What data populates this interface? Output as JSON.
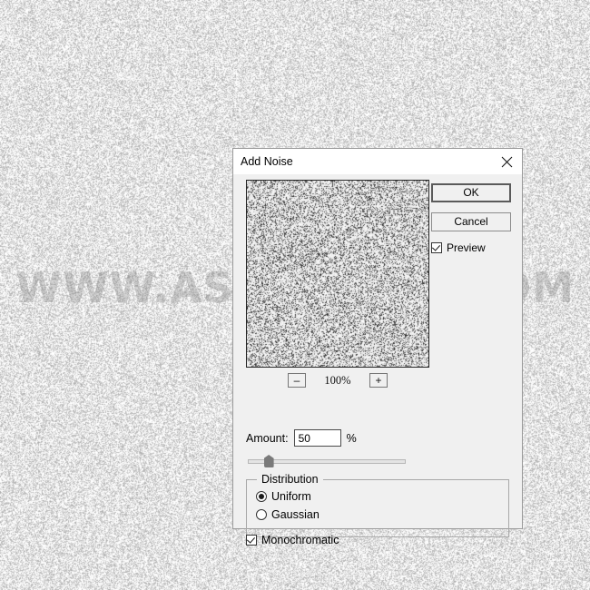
{
  "background": {
    "watermark_text": "WWW.ASDFGHJKL.COM",
    "noise_description": "monochromatic-uniform-noise"
  },
  "dialog": {
    "title": "Add Noise",
    "close_icon": "close-icon",
    "buttons": {
      "ok_label": "OK",
      "cancel_label": "Cancel"
    },
    "preview_checkbox": {
      "label": "Preview",
      "checked": true
    },
    "preview": {
      "zoom_out_label": "–",
      "zoom_in_label": "+",
      "zoom_level": "100%"
    },
    "amount": {
      "label": "Amount:",
      "value": "50",
      "unit": "%",
      "slider_percent": 13
    },
    "distribution": {
      "legend": "Distribution",
      "options": [
        {
          "label": "Uniform",
          "selected": true
        },
        {
          "label": "Gaussian",
          "selected": false
        }
      ]
    },
    "monochromatic": {
      "label": "Monochromatic",
      "checked": true
    }
  },
  "colors": {
    "dialog_face": "#f0f0f0",
    "titlebar": "#ffffff",
    "border": "#9a9a9a",
    "default_button_border": "#5a5a5a",
    "slider_thumb": "#7a7a7a"
  }
}
